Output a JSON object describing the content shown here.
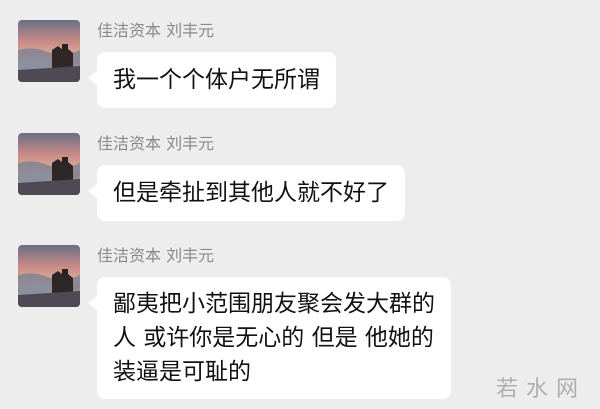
{
  "messages": [
    {
      "sender": "佳洁资本  刘丰元",
      "lines": [
        "我一个个体户无所谓"
      ]
    },
    {
      "sender": "佳洁资本  刘丰元",
      "lines": [
        "但是牵扯到其他人就不好了"
      ]
    },
    {
      "sender": "佳洁资本  刘丰元",
      "lines": [
        "鄙夷把小范围朋友聚会发大群的",
        "人 或许你是无心的 但是 他她的",
        "装逼是可耻的"
      ]
    }
  ],
  "avatar_icon": "sunset-landscape-photo",
  "watermark": "若水网",
  "colors": {
    "background": "#ededed",
    "bubble": "#ffffff",
    "sender_text": "#8a8a8a",
    "message_text": "#111111"
  }
}
